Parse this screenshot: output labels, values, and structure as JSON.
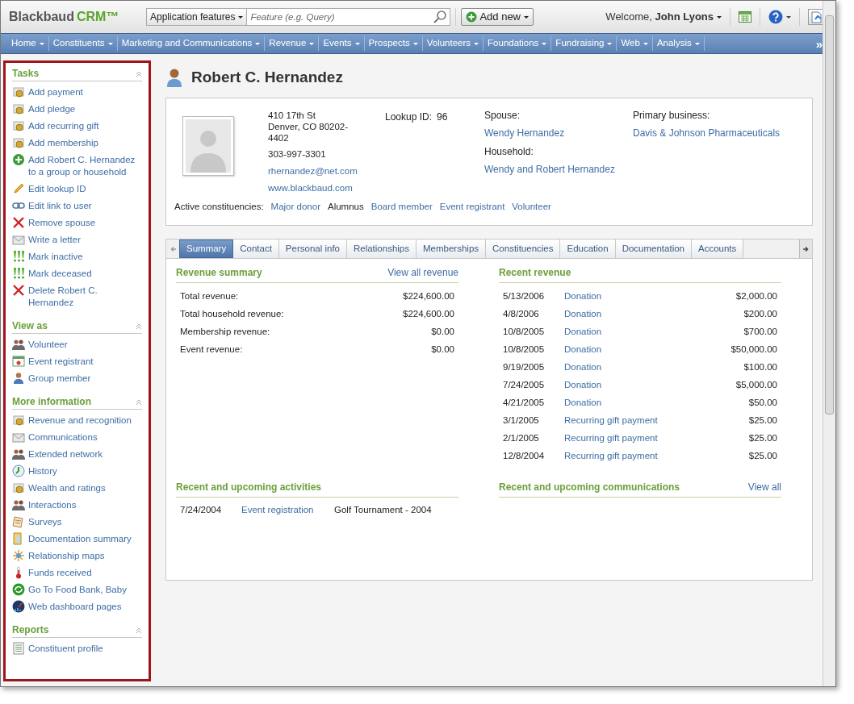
{
  "header": {
    "logo": "Blackbaud",
    "logo_suffix": "CRM™",
    "search_scope": "Application features",
    "search": {
      "placeholder": "Feature (e.g. Query)"
    },
    "add_button": "Add new",
    "welcome": "Welcome, **John Lyons**"
  },
  "nav": [
    {
      "label": "Home"
    },
    {
      "label": "Constituents"
    },
    {
      "label": "Marketing and Communications"
    },
    {
      "label": "Revenue"
    },
    {
      "label": "Events"
    },
    {
      "label": "Prospects"
    },
    {
      "label": "Volunteers"
    },
    {
      "label": "Foundations"
    },
    {
      "label": "Fundraising"
    },
    {
      "label": "Web"
    },
    {
      "label": "Analysis"
    }
  ],
  "nav_more": "»",
  "sidebar": [
    {
      "title": "Tasks",
      "items": [
        {
          "label": "Add payment"
        },
        {
          "label": "Add pledge"
        },
        {
          "label": "Add recurring gift"
        },
        {
          "label": "Add membership"
        },
        {
          "label": "Add Robert C. Hernandez to a group or household"
        },
        {
          "label": "Edit lookup ID"
        },
        {
          "label": "Edit link to user"
        },
        {
          "label": "Remove spouse"
        },
        {
          "label": "Write a letter"
        },
        {
          "label": "Mark inactive"
        },
        {
          "label": "Mark deceased"
        },
        {
          "label": "Delete Robert C. Hernandez"
        }
      ]
    },
    {
      "title": "View as",
      "items": [
        {
          "label": "Volunteer"
        },
        {
          "label": "Event registrant"
        },
        {
          "label": "Group member"
        }
      ]
    },
    {
      "title": "More information",
      "items": [
        {
          "label": "Revenue and recognition"
        },
        {
          "label": "Communications"
        },
        {
          "label": "Extended network"
        },
        {
          "label": "History"
        },
        {
          "label": "Wealth and ratings"
        },
        {
          "label": "Interactions"
        },
        {
          "label": "Surveys"
        },
        {
          "label": "Documentation summary"
        },
        {
          "label": "Relationship maps"
        },
        {
          "label": "Funds received"
        },
        {
          "label": "Go To Food Bank, Baby"
        },
        {
          "label": "Web dashboard pages"
        }
      ]
    },
    {
      "title": "Reports",
      "items": [
        {
          "label": "Constituent profile"
        }
      ]
    }
  ],
  "record": {
    "name": "Robert C. Hernandez",
    "address": [
      "410 17th St",
      "Denver, CO  80202-4402"
    ],
    "phone": "303-997-3301",
    "email": "rhernandez@net.com",
    "website": "www.blackbaud.com",
    "lookup_label": "Lookup ID:",
    "lookup_id": "96",
    "spouse_label": "Spouse:",
    "spouse": "Wendy Hernandez",
    "household_label": "Household:",
    "household": "Wendy and Robert Hernandez",
    "business_label": "Primary business:",
    "business": "Davis & Johnson Pharmaceuticals",
    "constituencies_label": "Active constituencies:",
    "constituencies": [
      {
        "label": "Major donor",
        "link": true
      },
      {
        "label": "Alumnus",
        "link": false
      },
      {
        "label": "Board member",
        "link": true
      },
      {
        "label": "Event registrant",
        "link": true
      },
      {
        "label": "Volunteer",
        "link": true
      }
    ]
  },
  "tabs": [
    {
      "label": "Summary",
      "selected": true
    },
    {
      "label": "Contact",
      "selected": false
    },
    {
      "label": "Personal info",
      "selected": false
    },
    {
      "label": "Relationships",
      "selected": false
    },
    {
      "label": "Memberships",
      "selected": false
    },
    {
      "label": "Constituencies",
      "selected": false
    },
    {
      "label": "Education",
      "selected": false
    },
    {
      "label": "Documentation",
      "selected": false
    },
    {
      "label": "Accounts",
      "selected": false
    }
  ],
  "revenue_summary": {
    "title": "Revenue summary",
    "link": "View all revenue",
    "rows": [
      {
        "label": "Total revenue:",
        "value": "$224,600.00"
      },
      {
        "label": "Total household revenue:",
        "value": "$224,600.00"
      },
      {
        "label": "Membership revenue:",
        "value": "$0.00"
      },
      {
        "label": "Event revenue:",
        "value": "$0.00"
      }
    ]
  },
  "recent_revenue": {
    "title": "Recent revenue",
    "rows": [
      {
        "date": "5/13/2006",
        "type": "Donation",
        "amount": "$2,000.00"
      },
      {
        "date": "4/8/2006",
        "type": "Donation",
        "amount": "$200.00"
      },
      {
        "date": "10/8/2005",
        "type": "Donation",
        "amount": "$700.00"
      },
      {
        "date": "10/8/2005",
        "type": "Donation",
        "amount": "$50,000.00"
      },
      {
        "date": "9/19/2005",
        "type": "Donation",
        "amount": "$100.00"
      },
      {
        "date": "7/24/2005",
        "type": "Donation",
        "amount": "$5,000.00"
      },
      {
        "date": "4/21/2005",
        "type": "Donation",
        "amount": "$50.00"
      },
      {
        "date": "3/1/2005",
        "type": "Recurring gift payment",
        "amount": "$25.00"
      },
      {
        "date": "2/1/2005",
        "type": "Recurring gift payment",
        "amount": "$25.00"
      },
      {
        "date": "12/8/2004",
        "type": "Recurring gift payment",
        "amount": "$25.00"
      }
    ]
  },
  "activities": {
    "title": "Recent and upcoming activities",
    "rows": [
      {
        "date": "7/24/2004",
        "type": "Event registration",
        "name": "Golf Tournament - 2004"
      }
    ]
  },
  "communications": {
    "title": "Recent and upcoming communications",
    "link": "View all"
  }
}
